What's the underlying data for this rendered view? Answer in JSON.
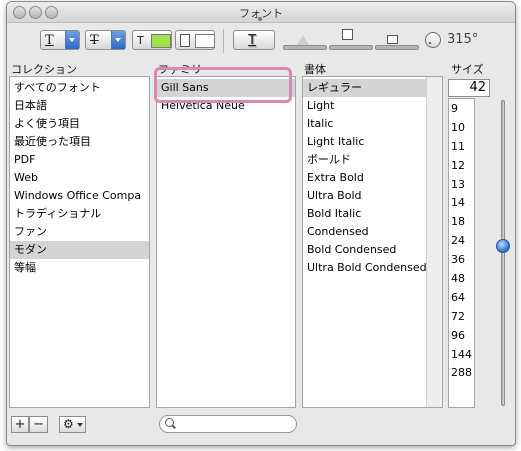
{
  "window": {
    "title": "フォント"
  },
  "toolbar": {
    "underline_glyph": "T",
    "strike_glyph": "T",
    "text_color_glyph": "T",
    "document_color_glyph": "",
    "shadow_glyph": "T",
    "rotation_value": "315°"
  },
  "colors": {
    "text_swatch": "#a0e04d",
    "document_swatch": "#ffffff",
    "selection_blue": "#3b7ed8",
    "highlight": "#dc89b1"
  },
  "collections": {
    "header": "コレクション",
    "items": [
      "すべてのフォント",
      "日本語",
      "よく使う項目",
      "最近使った項目",
      "PDF",
      "Web",
      "Windows Office Compa",
      "トラディショナル",
      "ファン",
      "モダン",
      "等幅"
    ],
    "selected_index": 9
  },
  "family": {
    "header": "ファミリー",
    "items": [
      "Gill Sans",
      "Helvetica Neue"
    ],
    "selected_index": 0
  },
  "typeface": {
    "header": "書体",
    "items": [
      "レギュラー",
      "Light",
      "Italic",
      "Light Italic",
      "ボールド",
      "Extra Bold",
      "Ultra Bold",
      "Bold Italic",
      "Condensed",
      "Bold Condensed",
      "Ultra Bold Condensed"
    ],
    "selected_index": 0
  },
  "size": {
    "header": "サイズ",
    "value": "42",
    "items": [
      "9",
      "10",
      "11",
      "12",
      "13",
      "14",
      "18",
      "24",
      "36",
      "48",
      "64",
      "72",
      "96",
      "144",
      "288"
    ]
  },
  "bottom": {
    "add_label": "+",
    "remove_label": "−",
    "search_placeholder": ""
  }
}
